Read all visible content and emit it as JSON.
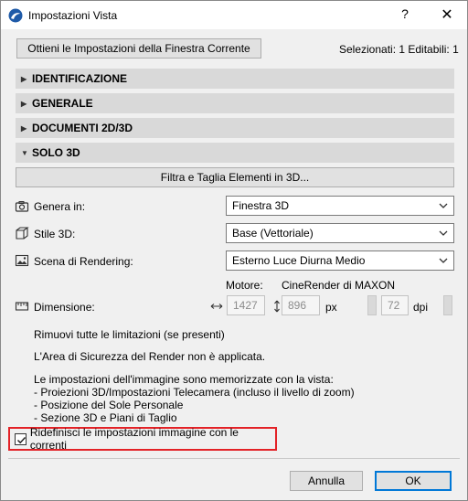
{
  "window": {
    "title": "Impostazioni Vista",
    "help": "?",
    "close": "✕"
  },
  "top": {
    "current_window_button": "Ottieni le Impostazioni della Finestra Corrente",
    "selection_info": "Selezionati: 1 Editabili: 1"
  },
  "sections": [
    {
      "label": "IDENTIFICAZIONE",
      "expanded": false
    },
    {
      "label": "GENERALE",
      "expanded": false
    },
    {
      "label": "DOCUMENTI 2D/3D",
      "expanded": false
    },
    {
      "label": "SOLO 3D",
      "expanded": true
    }
  ],
  "solo3d": {
    "filter_button": "Filtra e Taglia Elementi in 3D...",
    "genera_label": "Genera in:",
    "genera_value": "Finestra 3D",
    "stile_label": "Stile 3D:",
    "stile_value": "Base (Vettoriale)",
    "scena_label": "Scena di Rendering:",
    "scena_value": "Esterno Luce Diurna Medio",
    "motore_label": "Motore:",
    "motore_value": "CineRender di MAXON",
    "dimensione_label": "Dimensione:",
    "width": "1427",
    "height": "896",
    "size_unit": "px",
    "resolution": "72",
    "res_unit": "dpi",
    "remove_limits": "Rimuovi tutte le limitazioni (se presenti)",
    "safe_area": "L'Area di Sicurezza del Render non è applicata.",
    "note_title": "Le impostazioni dell'immagine sono memorizzate con la vista:",
    "note_items": [
      "- Proiezioni 3D/Impostazioni Telecamera (incluso il livello di zoom)",
      "- Posizione del Sole Personale",
      "- Sezione 3D e Piani di Taglio"
    ],
    "override_label": "Ridefinisci le impostazioni immagine con le correnti",
    "override_checked": true
  },
  "footer": {
    "cancel": "Annulla",
    "ok": "OK"
  },
  "colors": {
    "highlight_border": "#e32227",
    "section_bg": "#d9d9d9",
    "primary_border": "#0078d7"
  }
}
